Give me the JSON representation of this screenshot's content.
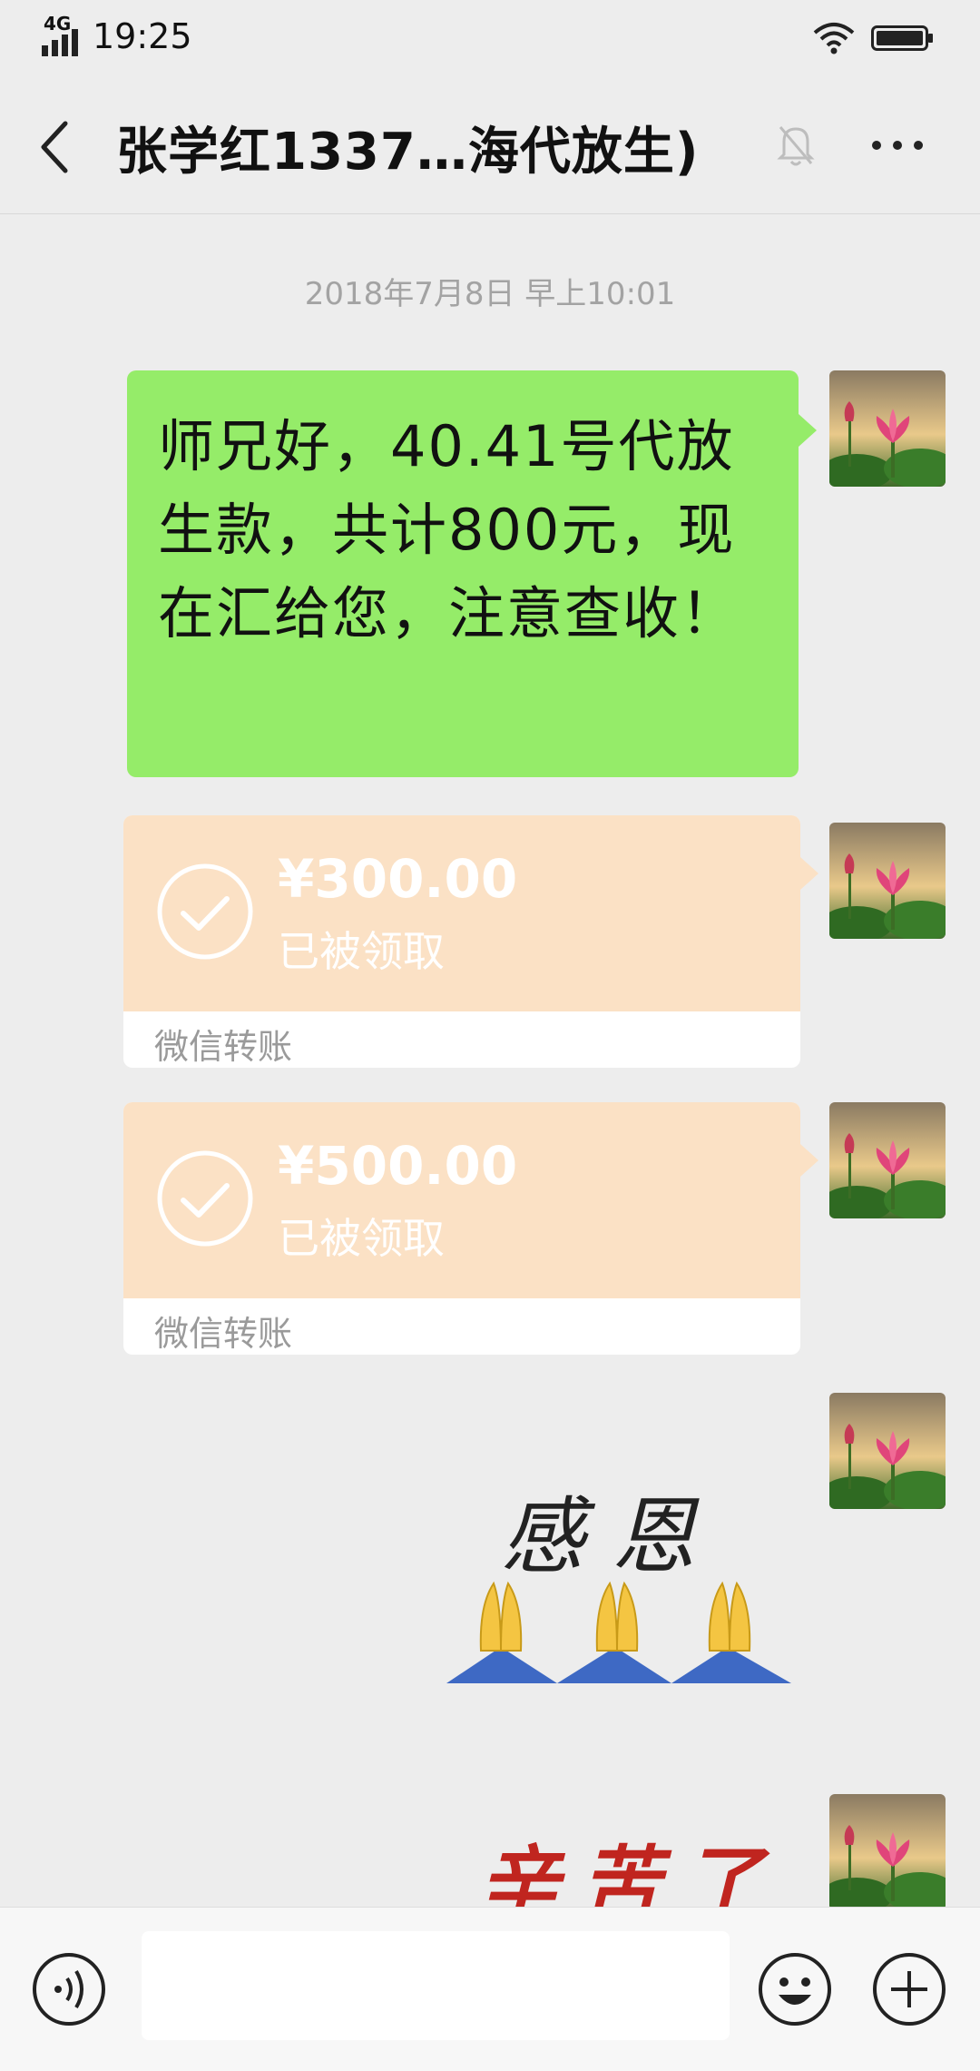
{
  "status_bar": {
    "network": "4G",
    "time": "19:25"
  },
  "header": {
    "title": "张学红1337…海代放生)"
  },
  "chat": {
    "timestamp": "2018年7月8日 早上10:01",
    "messages": [
      {
        "type": "text",
        "text": "师兄好，40.41号代放生款，共计800元，现在汇给您，注意查收！"
      },
      {
        "type": "transfer",
        "amount": "¥300.00",
        "status": "已被领取",
        "label": "微信转账"
      },
      {
        "type": "transfer",
        "amount": "¥500.00",
        "status": "已被领取",
        "label": "微信转账"
      },
      {
        "type": "sticker",
        "text": "感恩"
      },
      {
        "type": "sticker",
        "text": "辛苦了"
      }
    ]
  },
  "icons": [
    "back-icon",
    "mute-icon",
    "more-icon",
    "voice-icon",
    "emoji-icon",
    "plus-icon",
    "check-icon",
    "pray-icon"
  ],
  "colors": {
    "bubble_green": "#95ec69",
    "transfer_orange": "#fbe1c5",
    "sticker_red": "#c0251f"
  }
}
